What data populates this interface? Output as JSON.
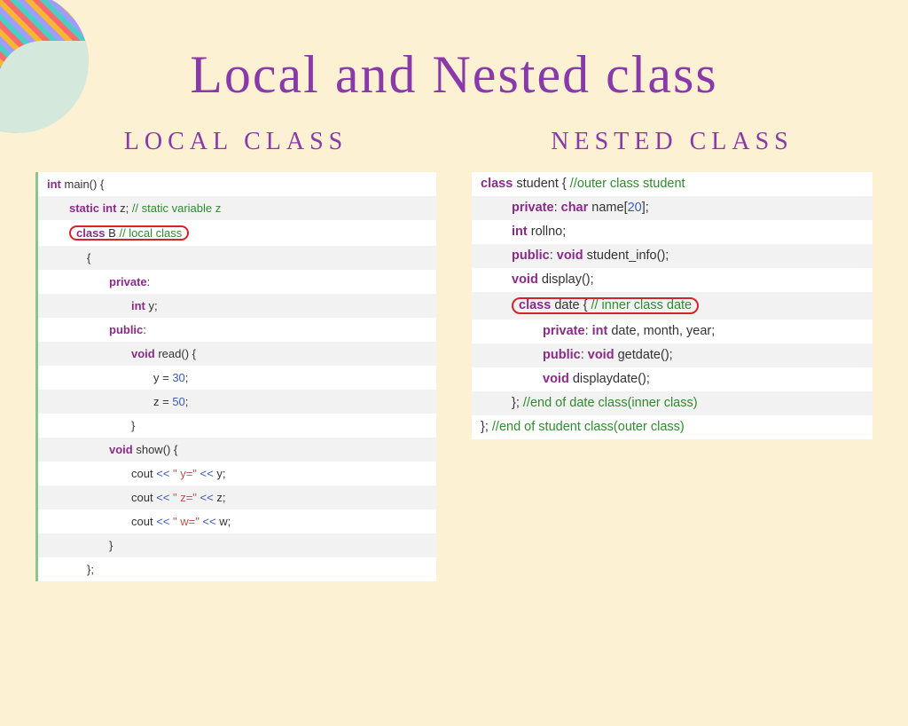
{
  "title": "Local and Nested class",
  "left": {
    "heading": "LOCAL CLASS",
    "lines": {
      "l0_kw": "int",
      "l0_rest": " main() {",
      "l1_kw": "static int",
      "l1_id": " z; ",
      "l1_cmt": "// static variable z",
      "l2_kw": "class",
      "l2_id": " B ",
      "l2_cmt": "// local class",
      "l3": "{",
      "l4_kw": "private",
      "l4_colon": ":",
      "l5_kw": "int",
      "l5_id": " y;",
      "l6_kw": "public",
      "l6_colon": ":",
      "l7_kw": "void",
      "l7_id": " read() {",
      "l8_id": "y = ",
      "l8_num": "30",
      "l8_semi": ";",
      "l9_id": "z = ",
      "l9_num": "50",
      "l9_semi": ";",
      "l10": "}",
      "l11_kw": "void",
      "l11_id": " show() {",
      "l12_id": "cout ",
      "l12_op1": "<<",
      "l12_str": " \" y=\" ",
      "l12_op2": "<<",
      "l12_var": " y;",
      "l13_id": "cout ",
      "l13_op1": "<<",
      "l13_str": " \" z=\" ",
      "l13_op2": "<<",
      "l13_var": " z;",
      "l14_id": "cout ",
      "l14_op1": "<<",
      "l14_str": " \" w=\" ",
      "l14_op2": "<<",
      "l14_var": " w;",
      "l15": "}",
      "l16": "};"
    }
  },
  "right": {
    "heading": "NESTED CLASS",
    "lines": {
      "r0_kw": "class",
      "r0_id": " student { ",
      "r0_cmt": "//outer class student",
      "r1_kw": "private",
      "r1_rest": ": ",
      "r1_kw2": "char",
      "r1_id": " name[",
      "r1_num": "20",
      "r1_close": "];",
      "r2_kw": "int",
      "r2_id": " rollno;",
      "r3_kw": "public",
      "r3_rest": ": ",
      "r3_kw2": "void",
      "r3_id": " student_info();",
      "r4_kw": "void",
      "r4_id": " display();",
      "r5_kw": "class",
      "r5_id": " date { ",
      "r5_cmt": "// inner class date",
      "r6_kw": "private",
      "r6_rest": ": ",
      "r6_kw2": "int",
      "r6_id": " date, month, year;",
      "r7_kw": "public",
      "r7_rest": ": ",
      "r7_kw2": "void",
      "r7_id": " getdate();",
      "r8_kw": "void",
      "r8_id": " displaydate();",
      "r9_id": "}; ",
      "r9_cmt": "//end of date class(inner class)",
      "r10_id": "}; ",
      "r10_cmt": "//end of student class(outer class)"
    }
  }
}
